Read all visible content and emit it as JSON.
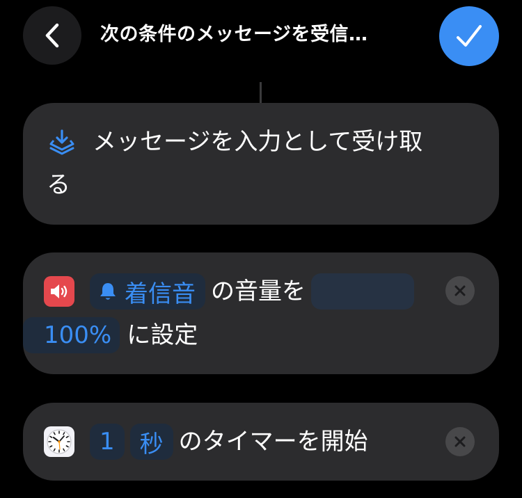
{
  "header": {
    "title": "次の条件のメッセージを受信…",
    "back_icon": "chevron-left-icon",
    "done_icon": "checkmark-icon",
    "accent_color": "#3a8ef4"
  },
  "actions": [
    {
      "icon": "tray-download-icon",
      "line1": "メッセージを入力として受け取",
      "line2": "る"
    },
    {
      "icon": "speaker-volume-icon",
      "icon_color": "#e5484d",
      "token_icon": "bell-icon",
      "token_label": "着信音",
      "text1": "の音量を",
      "value": "100%",
      "text2": "に設定"
    },
    {
      "icon": "clock-icon",
      "amount": "1",
      "unit": "秒",
      "text": "のタイマーを開始"
    }
  ]
}
